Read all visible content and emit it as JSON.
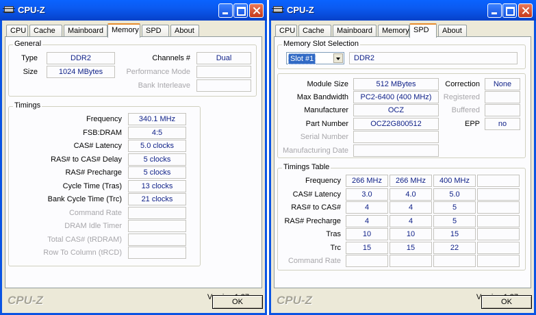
{
  "left_window": {
    "title": "CPU-Z",
    "tabs": [
      "CPU",
      "Cache",
      "Mainboard",
      "Memory",
      "SPD",
      "About"
    ],
    "active_tab": "Memory",
    "general": {
      "label": "General",
      "type_label": "Type",
      "type_value": "DDR2",
      "size_label": "Size",
      "size_value": "1024 MBytes",
      "channels_label": "Channels #",
      "channels_value": "Dual",
      "perf_mode_label": "Performance Mode",
      "perf_mode_value": "",
      "bank_interleave_label": "Bank Interleave",
      "bank_interleave_value": ""
    },
    "timings": {
      "label": "Timings",
      "rows": [
        {
          "label": "Frequency",
          "value": "340.1 MHz",
          "dim": false
        },
        {
          "label": "FSB:DRAM",
          "value": "4:5",
          "dim": false
        },
        {
          "label": "CAS# Latency",
          "value": "5.0 clocks",
          "dim": false
        },
        {
          "label": "RAS# to CAS# Delay",
          "value": "5 clocks",
          "dim": false
        },
        {
          "label": "RAS# Precharge",
          "value": "5 clocks",
          "dim": false
        },
        {
          "label": "Cycle Time (Tras)",
          "value": "13 clocks",
          "dim": false
        },
        {
          "label": "Bank Cycle Time (Trc)",
          "value": "21 clocks",
          "dim": false
        },
        {
          "label": "Command Rate",
          "value": "",
          "dim": true
        },
        {
          "label": "DRAM Idle Timer",
          "value": "",
          "dim": true
        },
        {
          "label": "Total CAS# (tRDRAM)",
          "value": "",
          "dim": true
        },
        {
          "label": "Row To Column (tRCD)",
          "value": "",
          "dim": true
        }
      ]
    },
    "version": "Version 1.37",
    "brand": "CPU-Z",
    "ok_label": "OK"
  },
  "right_window": {
    "title": "CPU-Z",
    "tabs": [
      "CPU",
      "Cache",
      "Mainboard",
      "Memory",
      "SPD",
      "About"
    ],
    "active_tab": "SPD",
    "slot_group_label": "Memory Slot Selection",
    "slot_selected": "Slot #1",
    "slot_type": "DDR2",
    "module": {
      "module_size_label": "Module Size",
      "module_size_value": "512 MBytes",
      "max_bw_label": "Max Bandwidth",
      "max_bw_value": "PC2-6400 (400 MHz)",
      "manufacturer_label": "Manufacturer",
      "manufacturer_value": "OCZ",
      "part_label": "Part Number",
      "part_value": "OCZ2G800512",
      "serial_label": "Serial Number",
      "serial_value": "",
      "mfg_date_label": "Manufacturing Date",
      "mfg_date_value": "",
      "correction_label": "Correction",
      "correction_value": "None",
      "registered_label": "Registered",
      "registered_value": "",
      "buffered_label": "Buffered",
      "buffered_value": "",
      "epp_label": "EPP",
      "epp_value": "no"
    },
    "timings_table": {
      "label": "Timings Table",
      "rows": [
        {
          "label": "Frequency",
          "values": [
            "266 MHz",
            "266 MHz",
            "400 MHz",
            ""
          ],
          "dim": false
        },
        {
          "label": "CAS# Latency",
          "values": [
            "3.0",
            "4.0",
            "5.0",
            ""
          ],
          "dim": false
        },
        {
          "label": "RAS# to CAS#",
          "values": [
            "4",
            "4",
            "5",
            ""
          ],
          "dim": false
        },
        {
          "label": "RAS# Precharge",
          "values": [
            "4",
            "4",
            "5",
            ""
          ],
          "dim": false
        },
        {
          "label": "Tras",
          "values": [
            "10",
            "10",
            "15",
            ""
          ],
          "dim": false
        },
        {
          "label": "Trc",
          "values": [
            "15",
            "15",
            "22",
            ""
          ],
          "dim": false
        },
        {
          "label": "Command Rate",
          "values": [
            "",
            "",
            "",
            ""
          ],
          "dim": true
        }
      ]
    },
    "version": "Version 1.37",
    "brand": "CPU-Z",
    "ok_label": "OK"
  }
}
